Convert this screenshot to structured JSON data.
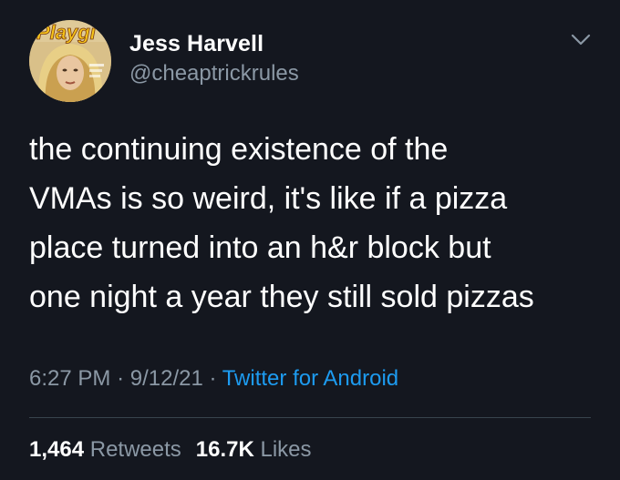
{
  "tweet": {
    "author": {
      "name": "Jess Harvell",
      "handle": "@cheaptrickrules",
      "avatar_logo_text": "Playgirl"
    },
    "text": "the continuing existence of the\nVMAs is so weird, it's like if a pizza\nplace turned into an h&r block but\none night a year they still sold pizzas",
    "time": "6:27 PM",
    "date": "9/12/21",
    "separator": "·",
    "source": "Twitter for Android",
    "retweets": {
      "count": "1,464",
      "label": "Retweets"
    },
    "likes": {
      "count": "16.7K",
      "label": "Likes"
    }
  },
  "colors": {
    "background": "#14171f",
    "primary_text": "#ffffff",
    "secondary_text": "#8b98a5",
    "link": "#1d9bf0",
    "divider": "#38444d"
  },
  "icons": {
    "menu": "chevron-down-icon"
  }
}
